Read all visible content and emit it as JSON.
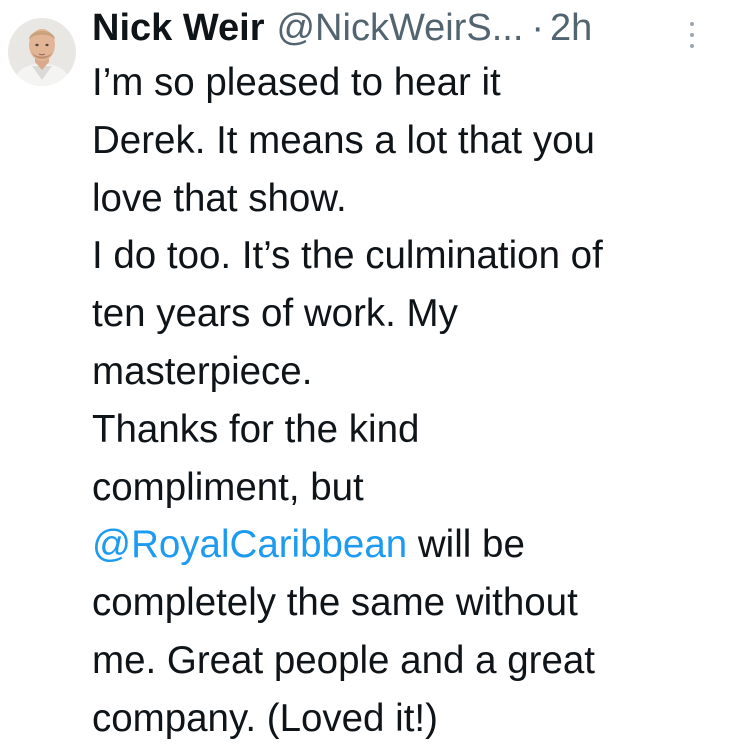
{
  "tweet": {
    "author": {
      "display_name": "Nick Weir",
      "handle": "@NickWeirS...",
      "avatar_icon": "profile-photo"
    },
    "separator": "·",
    "time": "2h",
    "more_icon": "vertical-ellipsis-icon",
    "lines": [
      {
        "text": "I’m so pleased to hear it"
      },
      {
        "text": "Derek. It means a lot that you"
      },
      {
        "text": "love that show."
      },
      {
        "text": "I do too. It’s the culmination of"
      },
      {
        "text": "ten years of work. My"
      },
      {
        "text": "masterpiece."
      },
      {
        "text": "Thanks for the kind"
      },
      {
        "text": "compliment, but"
      },
      {
        "mention": "@RoyalCaribbean",
        "text": " will be"
      },
      {
        "text": "completely the same without"
      },
      {
        "text": "me. Great people and a great"
      },
      {
        "text": "company. (Loved it!)"
      }
    ],
    "colors": {
      "text": "#0f1419",
      "secondary": "#536471",
      "link": "#1d9bf0"
    }
  }
}
